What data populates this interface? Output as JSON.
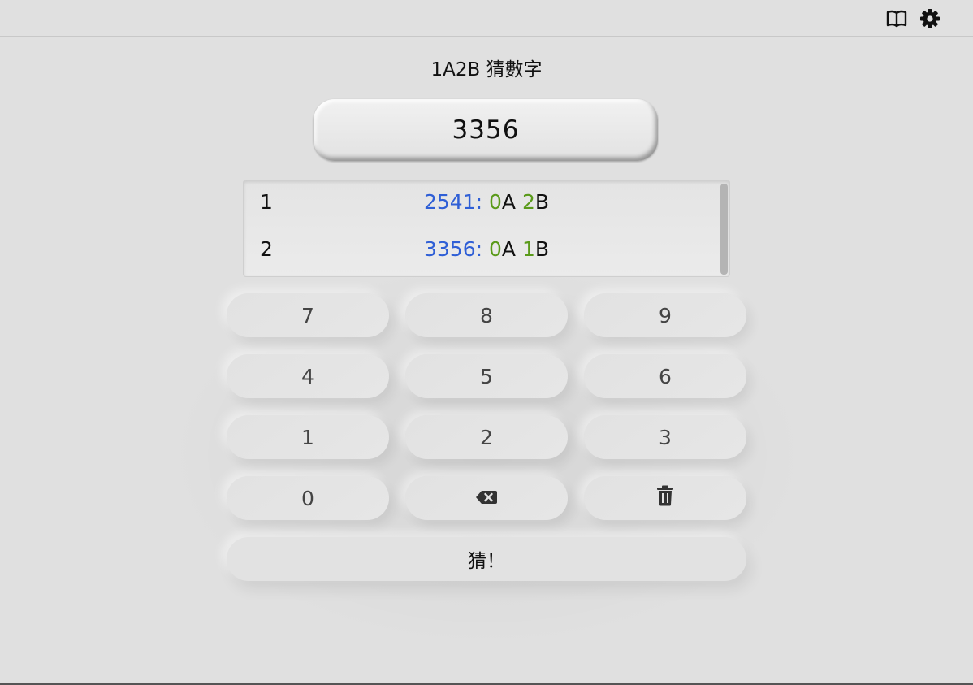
{
  "header": {
    "icons": [
      "book-icon",
      "gear-icon"
    ]
  },
  "title": "1A2B 猜數字",
  "display_value": "3356",
  "history": [
    {
      "index": "1",
      "guess": "2541:",
      "a": "0",
      "a_label": "A",
      "b": "2",
      "b_label": "B"
    },
    {
      "index": "2",
      "guess": "3356:",
      "a": "0",
      "a_label": "A",
      "b": "1",
      "b_label": "B"
    }
  ],
  "keypad": {
    "k7": "7",
    "k8": "8",
    "k9": "9",
    "k4": "4",
    "k5": "5",
    "k6": "6",
    "k1": "1",
    "k2": "2",
    "k3": "3",
    "k0": "0",
    "backspace_icon": "backspace-icon",
    "clear_icon": "trash-icon",
    "guess_label": "猜！"
  },
  "colors": {
    "background": "#e0e0e0",
    "guess_text": "#2f5fd6",
    "count_text": "#5a9a1a"
  }
}
